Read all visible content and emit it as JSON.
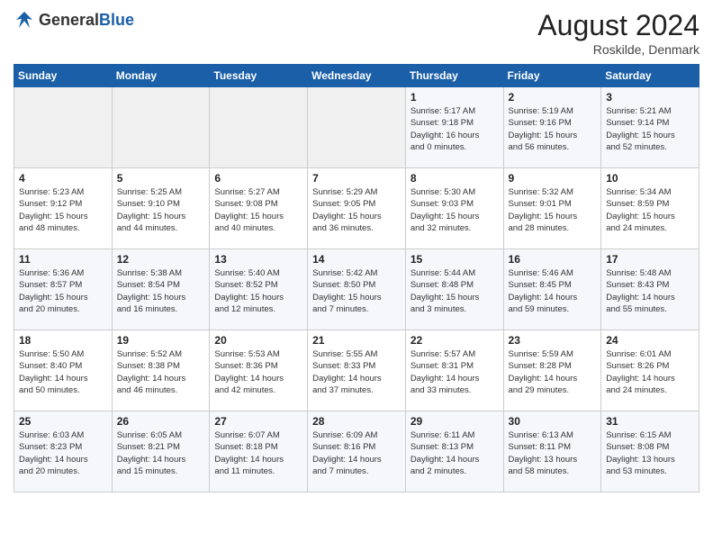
{
  "header": {
    "logo_general": "General",
    "logo_blue": "Blue",
    "month_year": "August 2024",
    "location": "Roskilde, Denmark"
  },
  "days_of_week": [
    "Sunday",
    "Monday",
    "Tuesday",
    "Wednesday",
    "Thursday",
    "Friday",
    "Saturday"
  ],
  "weeks": [
    [
      {
        "day": "",
        "info": ""
      },
      {
        "day": "",
        "info": ""
      },
      {
        "day": "",
        "info": ""
      },
      {
        "day": "",
        "info": ""
      },
      {
        "day": "1",
        "info": "Sunrise: 5:17 AM\nSunset: 9:18 PM\nDaylight: 16 hours\nand 0 minutes."
      },
      {
        "day": "2",
        "info": "Sunrise: 5:19 AM\nSunset: 9:16 PM\nDaylight: 15 hours\nand 56 minutes."
      },
      {
        "day": "3",
        "info": "Sunrise: 5:21 AM\nSunset: 9:14 PM\nDaylight: 15 hours\nand 52 minutes."
      }
    ],
    [
      {
        "day": "4",
        "info": "Sunrise: 5:23 AM\nSunset: 9:12 PM\nDaylight: 15 hours\nand 48 minutes."
      },
      {
        "day": "5",
        "info": "Sunrise: 5:25 AM\nSunset: 9:10 PM\nDaylight: 15 hours\nand 44 minutes."
      },
      {
        "day": "6",
        "info": "Sunrise: 5:27 AM\nSunset: 9:08 PM\nDaylight: 15 hours\nand 40 minutes."
      },
      {
        "day": "7",
        "info": "Sunrise: 5:29 AM\nSunset: 9:05 PM\nDaylight: 15 hours\nand 36 minutes."
      },
      {
        "day": "8",
        "info": "Sunrise: 5:30 AM\nSunset: 9:03 PM\nDaylight: 15 hours\nand 32 minutes."
      },
      {
        "day": "9",
        "info": "Sunrise: 5:32 AM\nSunset: 9:01 PM\nDaylight: 15 hours\nand 28 minutes."
      },
      {
        "day": "10",
        "info": "Sunrise: 5:34 AM\nSunset: 8:59 PM\nDaylight: 15 hours\nand 24 minutes."
      }
    ],
    [
      {
        "day": "11",
        "info": "Sunrise: 5:36 AM\nSunset: 8:57 PM\nDaylight: 15 hours\nand 20 minutes."
      },
      {
        "day": "12",
        "info": "Sunrise: 5:38 AM\nSunset: 8:54 PM\nDaylight: 15 hours\nand 16 minutes."
      },
      {
        "day": "13",
        "info": "Sunrise: 5:40 AM\nSunset: 8:52 PM\nDaylight: 15 hours\nand 12 minutes."
      },
      {
        "day": "14",
        "info": "Sunrise: 5:42 AM\nSunset: 8:50 PM\nDaylight: 15 hours\nand 7 minutes."
      },
      {
        "day": "15",
        "info": "Sunrise: 5:44 AM\nSunset: 8:48 PM\nDaylight: 15 hours\nand 3 minutes."
      },
      {
        "day": "16",
        "info": "Sunrise: 5:46 AM\nSunset: 8:45 PM\nDaylight: 14 hours\nand 59 minutes."
      },
      {
        "day": "17",
        "info": "Sunrise: 5:48 AM\nSunset: 8:43 PM\nDaylight: 14 hours\nand 55 minutes."
      }
    ],
    [
      {
        "day": "18",
        "info": "Sunrise: 5:50 AM\nSunset: 8:40 PM\nDaylight: 14 hours\nand 50 minutes."
      },
      {
        "day": "19",
        "info": "Sunrise: 5:52 AM\nSunset: 8:38 PM\nDaylight: 14 hours\nand 46 minutes."
      },
      {
        "day": "20",
        "info": "Sunrise: 5:53 AM\nSunset: 8:36 PM\nDaylight: 14 hours\nand 42 minutes."
      },
      {
        "day": "21",
        "info": "Sunrise: 5:55 AM\nSunset: 8:33 PM\nDaylight: 14 hours\nand 37 minutes."
      },
      {
        "day": "22",
        "info": "Sunrise: 5:57 AM\nSunset: 8:31 PM\nDaylight: 14 hours\nand 33 minutes."
      },
      {
        "day": "23",
        "info": "Sunrise: 5:59 AM\nSunset: 8:28 PM\nDaylight: 14 hours\nand 29 minutes."
      },
      {
        "day": "24",
        "info": "Sunrise: 6:01 AM\nSunset: 8:26 PM\nDaylight: 14 hours\nand 24 minutes."
      }
    ],
    [
      {
        "day": "25",
        "info": "Sunrise: 6:03 AM\nSunset: 8:23 PM\nDaylight: 14 hours\nand 20 minutes."
      },
      {
        "day": "26",
        "info": "Sunrise: 6:05 AM\nSunset: 8:21 PM\nDaylight: 14 hours\nand 15 minutes."
      },
      {
        "day": "27",
        "info": "Sunrise: 6:07 AM\nSunset: 8:18 PM\nDaylight: 14 hours\nand 11 minutes."
      },
      {
        "day": "28",
        "info": "Sunrise: 6:09 AM\nSunset: 8:16 PM\nDaylight: 14 hours\nand 7 minutes."
      },
      {
        "day": "29",
        "info": "Sunrise: 6:11 AM\nSunset: 8:13 PM\nDaylight: 14 hours\nand 2 minutes."
      },
      {
        "day": "30",
        "info": "Sunrise: 6:13 AM\nSunset: 8:11 PM\nDaylight: 13 hours\nand 58 minutes."
      },
      {
        "day": "31",
        "info": "Sunrise: 6:15 AM\nSunset: 8:08 PM\nDaylight: 13 hours\nand 53 minutes."
      }
    ]
  ]
}
